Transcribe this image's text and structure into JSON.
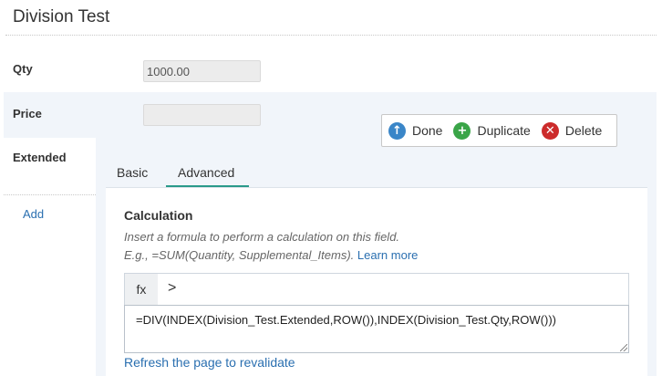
{
  "page": {
    "title": "Division Test"
  },
  "fields": [
    {
      "label": "Qty",
      "value": "1000.00"
    },
    {
      "label": "Price",
      "value": ""
    },
    {
      "label": "Extended"
    }
  ],
  "add_label": "Add",
  "actions": {
    "done": "Done",
    "duplicate": "Duplicate",
    "delete": "Delete"
  },
  "colors": {
    "done": "#3a86c8",
    "duplicate": "#3aa548",
    "delete": "#cc2b2b",
    "accent_tab": "#2a9a8a",
    "link": "#2a6fb0"
  },
  "tabs": {
    "basic": "Basic",
    "advanced": "Advanced",
    "active": "advanced"
  },
  "calculation": {
    "title": "Calculation",
    "hint_line1": "Insert a formula to perform a calculation on this field.",
    "hint_line2": "E.g., =SUM(Quantity, Supplemental_Items).",
    "learn_more": "Learn more",
    "fx_label": "fx",
    "chevron": ">",
    "formula": "=DIV(INDEX(Division_Test.Extended,ROW()),INDEX(Division_Test.Qty,ROW()))",
    "refresh": "Refresh the page to revalidate"
  }
}
